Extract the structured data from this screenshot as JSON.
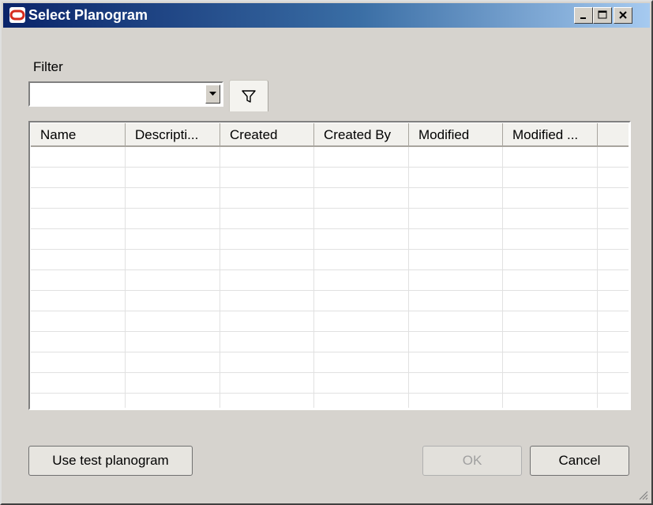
{
  "window": {
    "title": "Select Planogram",
    "app_icon": "oracle-logo-icon",
    "controls": [
      "minimize-icon",
      "maximize-icon",
      "close-icon"
    ]
  },
  "filter": {
    "label": "Filter",
    "value": "",
    "filter_icon": "funnel-icon"
  },
  "grid": {
    "columns": [
      "Name",
      "Descripti...",
      "Created",
      "Created By",
      "Modified",
      "Modified ..."
    ],
    "rows": []
  },
  "buttons": {
    "use_test": "Use test planogram",
    "ok": "OK",
    "cancel": "Cancel"
  },
  "colors": {
    "title_start": "#0a246a",
    "title_end": "#a6caf0",
    "logo_red": "#d52b1e"
  }
}
